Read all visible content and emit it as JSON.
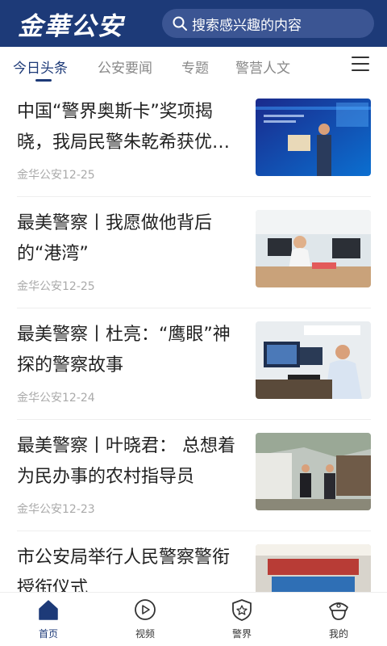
{
  "header": {
    "logo_text": "金華公安",
    "search_placeholder": "搜索感兴趣的内容"
  },
  "tabs": [
    {
      "label": "今日头条",
      "active": true
    },
    {
      "label": "公安要闻",
      "active": false
    },
    {
      "label": "专题",
      "active": false
    },
    {
      "label": "警营人文",
      "active": false
    }
  ],
  "feed": [
    {
      "title": "中国“警界奥斯卡”奖项揭晓，我局民警朱乾希获优…",
      "meta": "金华公安12-25",
      "thumb": "award-ceremony-photo"
    },
    {
      "title": "最美警察丨我愿做他背后的“港湾”",
      "meta": "金华公安12-25",
      "thumb": "office-woman-photo"
    },
    {
      "title": "最美警察丨杜亮：“鹰眼”神探的警察故事",
      "meta": "金华公安12-24",
      "thumb": "officer-at-computer-photo"
    },
    {
      "title": "最美警察丨叶晓君： 总想着为民办事的农村指导员",
      "meta": "金华公安12-23",
      "thumb": "village-visit-photo"
    },
    {
      "title": "市公安局举行人民警察警衔授衔仪式",
      "meta": "",
      "thumb": "auditorium-ceremony-photo"
    }
  ],
  "bottom_nav": [
    {
      "label": "首页",
      "icon": "home-icon",
      "active": true
    },
    {
      "label": "视频",
      "icon": "play-icon",
      "active": false
    },
    {
      "label": "警界",
      "icon": "police-badge-icon",
      "active": false
    },
    {
      "label": "我的",
      "icon": "police-cap-icon",
      "active": false
    }
  ],
  "colors": {
    "brand": "#1d3a78",
    "inactive_text": "#888888"
  }
}
